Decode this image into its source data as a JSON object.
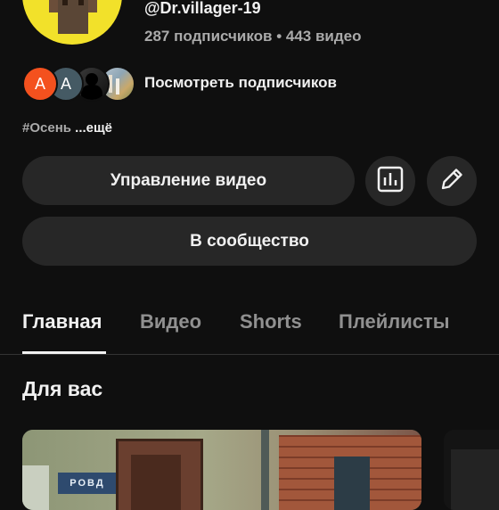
{
  "channel": {
    "handle": "@Dr.villager-19",
    "stats": "287 подписчиков • 443 видео",
    "subscriber_avatars": [
      "A",
      "A"
    ],
    "view_subscribers_label": "Посмотреть подписчиков",
    "tag": "#Осень",
    "more_label": "...ещё"
  },
  "actions": {
    "manage_videos_label": "Управление видео",
    "community_label": "В сообщество",
    "analytics_icon": "analytics-icon",
    "edit_icon": "pencil-icon"
  },
  "tabs": [
    {
      "label": "Главная",
      "active": true
    },
    {
      "label": "Видео",
      "active": false
    },
    {
      "label": "Shorts",
      "active": false
    },
    {
      "label": "Плейлисты",
      "active": false
    }
  ],
  "section": {
    "title": "Для вас"
  },
  "thumbnails": [
    {
      "sign_text": "РОВД"
    },
    {}
  ],
  "colors": {
    "background": "#0f0f0f",
    "button": "#272727",
    "subscriber_1": "#f4511e",
    "subscriber_2": "#455a64",
    "avatar_bg": "#f2e12a"
  }
}
